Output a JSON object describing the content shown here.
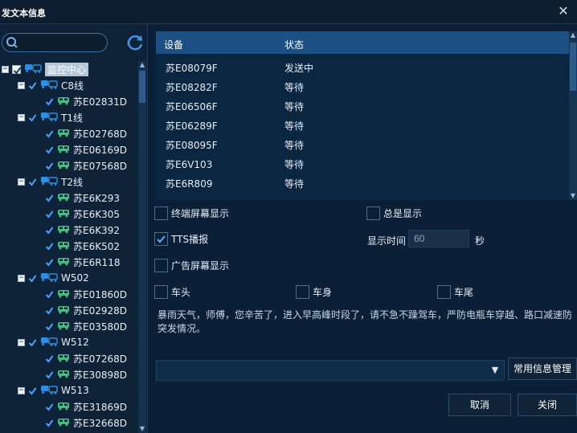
{
  "window": {
    "title": "发文本信息",
    "close": "✕"
  },
  "tree": {
    "root": {
      "label": "监控中心"
    },
    "groups": [
      {
        "label": "C8线",
        "vehicles": [
          "苏E02831D"
        ]
      },
      {
        "label": "T1线",
        "vehicles": [
          "苏E02768D",
          "苏E06169D",
          "苏E07568D"
        ]
      },
      {
        "label": "T2线",
        "vehicles": [
          "苏E6K293",
          "苏E6K305",
          "苏E6K392",
          "苏E6K502",
          "苏E6R118"
        ]
      },
      {
        "label": "W502",
        "vehicles": [
          "苏E01860D",
          "苏E02928D",
          "苏E03580D"
        ]
      },
      {
        "label": "W512",
        "vehicles": [
          "苏E07268D",
          "苏E30898D"
        ]
      },
      {
        "label": "W513",
        "vehicles": [
          "苏E31869D",
          "苏E32668D"
        ]
      }
    ]
  },
  "grid": {
    "columns": [
      "设备",
      "状态"
    ],
    "rows": [
      [
        "苏E08079F",
        "发送中"
      ],
      [
        "苏E08282F",
        "等待"
      ],
      [
        "苏E06506F",
        "等待"
      ],
      [
        "苏E06289F",
        "等待"
      ],
      [
        "苏E08095F",
        "等待"
      ],
      [
        "苏E6V103",
        "等待"
      ],
      [
        "苏E6R809",
        "等待"
      ]
    ]
  },
  "options": {
    "terminal_display": {
      "label": "终端屏幕显示",
      "checked": false
    },
    "always_display": {
      "label": "总是显示",
      "checked": false
    },
    "tts": {
      "label": "TTS播报",
      "checked": true
    },
    "ad_display": {
      "label": "广告屏幕显示",
      "checked": false
    },
    "front": {
      "label": "车头",
      "checked": false
    },
    "body": {
      "label": "车身",
      "checked": false
    },
    "tail": {
      "label": "车尾",
      "checked": false
    }
  },
  "display_time": {
    "label": "显示时间",
    "value": "60",
    "unit": "秒"
  },
  "message": "暴雨天气，师傅，您辛苦了，进入早高峰时段了，请不急不躁驾车，严防电瓶车穿越、路口减速防突发情况。",
  "buttons": {
    "common_msg": "常用信息管理",
    "cancel": "取消",
    "close": "关闭"
  },
  "colors": {
    "accent": "#1c4f84",
    "check_blue": "#4aa3ff",
    "car_green": "#3dc37a",
    "bus_blue": "#2f8de4"
  }
}
